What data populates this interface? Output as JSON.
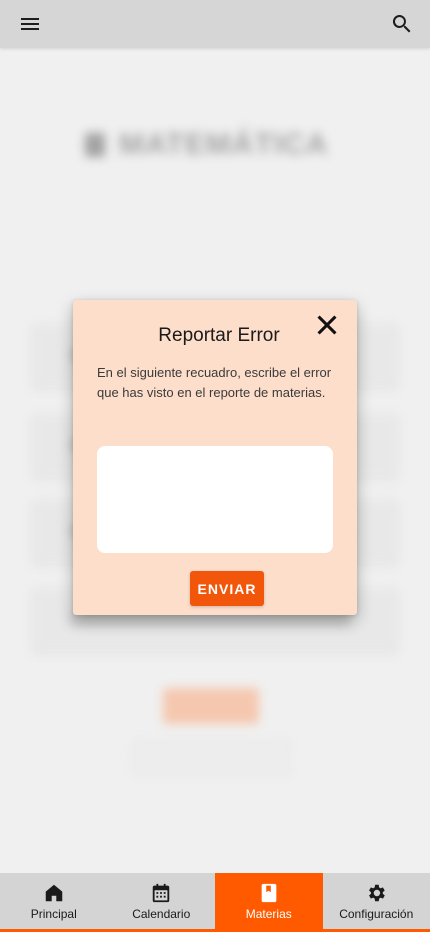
{
  "app_bar": {
    "menu_icon": "hamburger-menu-icon",
    "search_icon": "search-icon"
  },
  "background_page": {
    "title": "MATEMÁTICA"
  },
  "dialog": {
    "title": "Reportar Error",
    "description": "En el siguiente recuadro, escribe el error que has visto en el reporte de materias.",
    "textarea_value": "",
    "send_label": "ENVIAR",
    "close_icon": "close-icon"
  },
  "bottom_nav": {
    "items": [
      {
        "label": "Principal",
        "icon": "home-icon",
        "active": false
      },
      {
        "label": "Calendario",
        "icon": "calendar-icon",
        "active": false
      },
      {
        "label": "Materias",
        "icon": "book-icon",
        "active": true
      },
      {
        "label": "Configuración",
        "icon": "gear-icon",
        "active": false
      }
    ]
  },
  "colors": {
    "accent": "#ff5a00",
    "dialog_background": "#fddecb",
    "send_button": "#f2560a",
    "nav_background": "#d4d4d4"
  }
}
